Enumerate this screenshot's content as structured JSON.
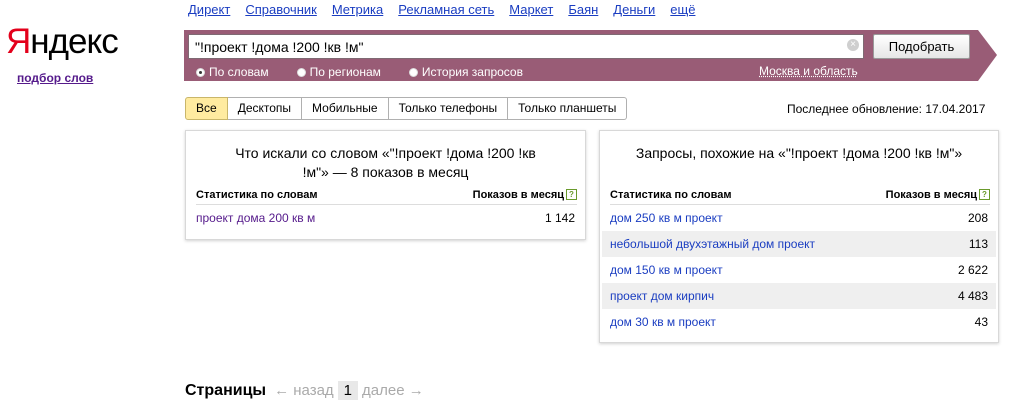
{
  "logo": {
    "first_letter": "Я",
    "rest": "ндекс"
  },
  "sublink": "подбор слов",
  "topnav": [
    "Директ",
    "Справочник",
    "Метрика",
    "Рекламная сеть",
    "Маркет",
    "Баян",
    "Деньги",
    "ещё"
  ],
  "search": {
    "query": "\"!проект !дома !200 !кв !м\"",
    "clear_icon": "×",
    "button": "Подобрать"
  },
  "radios": [
    {
      "label": "По словам",
      "checked": true
    },
    {
      "label": "По регионам",
      "checked": false
    },
    {
      "label": "История запросов",
      "checked": false
    }
  ],
  "region": "Москва и область",
  "tabs": [
    "Все",
    "Десктопы",
    "Мобильные",
    "Только телефоны",
    "Только планшеты"
  ],
  "updated": "Последнее обновление: 17.04.2017",
  "left_panel": {
    "title_line1": "Что искали со словом «\"!проект !дома !200 !кв",
    "title_line2": "!м\"» — 8 показов в месяц",
    "col1": "Статистика по словам",
    "col2": "Показов в месяц",
    "help": "?",
    "rows": [
      {
        "phrase": "проект дома 200 кв м",
        "count": "1 142"
      }
    ]
  },
  "right_panel": {
    "title": "Запросы, похожие на «\"!проект !дома !200 !кв !м\"»",
    "col1": "Статистика по словам",
    "col2": "Показов в месяц",
    "help": "?",
    "rows": [
      {
        "phrase": "дом 250 кв м проект",
        "count": "208"
      },
      {
        "phrase": "небольшой двухэтажный дом проект",
        "count": "113"
      },
      {
        "phrase": "дом 150 кв м проект",
        "count": "2 622"
      },
      {
        "phrase": "проект дом кирпич",
        "count": "4 483"
      },
      {
        "phrase": "дом 30 кв м проект",
        "count": "43"
      }
    ]
  },
  "pager": {
    "label": "Страницы",
    "prev": "← назад",
    "current": "1",
    "next": "далее →"
  },
  "colors": {
    "band": "#995c76",
    "active_tab": "#ffeba0",
    "logo_red": "#e3001b"
  }
}
